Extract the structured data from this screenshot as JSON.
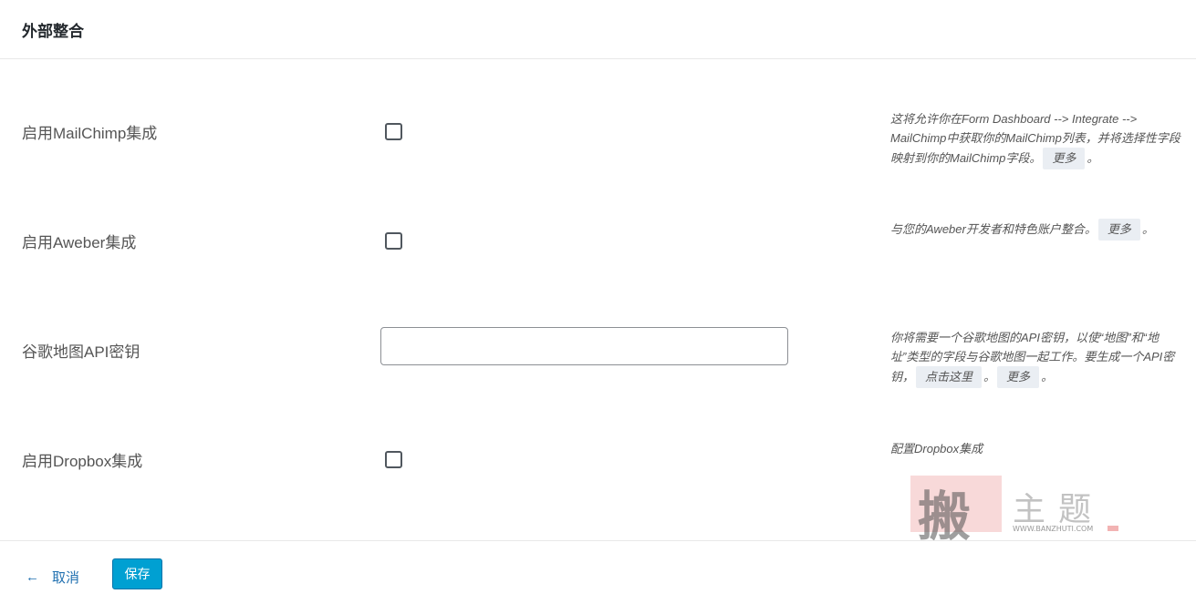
{
  "header": {
    "title": "外部整合"
  },
  "rows": [
    {
      "label": "启用MailChimp集成",
      "control": "checkbox",
      "checked": false,
      "desc_text": "这将允许你在Form Dashboard --> Integrate --> MailChimp中获取你的MailChimp列表，并将选择性字段映射到你的MailChimp字段。",
      "desc_links": [
        "更多"
      ],
      "desc_end": "。"
    },
    {
      "label": "启用Aweber集成",
      "control": "checkbox",
      "checked": false,
      "desc_text": "与您的Aweber开发者和特色账户整合。",
      "desc_links": [
        "更多"
      ],
      "desc_end": "。"
    },
    {
      "label": "谷歌地图API密钥",
      "control": "text",
      "value": "",
      "desc_text": "你将需要一个谷歌地图的API密钥，以使“地图”和“地址”类型的字段与谷歌地图一起工作。要生成一个API密钥，",
      "desc_links": [
        "点击这里",
        "更多"
      ],
      "desc_sep": "。",
      "desc_end": "。"
    },
    {
      "label": "启用Dropbox集成",
      "control": "checkbox",
      "checked": false,
      "desc_text": "配置Dropbox集成"
    }
  ],
  "watermark": {
    "seal_char": "搬",
    "text": "主题",
    "url": "WWW.BANZHUTI.COM"
  },
  "footer": {
    "cancel_icon": "arrow-left-icon",
    "cancel_arrow": "←",
    "cancel_label": "取消",
    "save_label": "保存"
  },
  "colors": {
    "accent": "#00a0d2",
    "link": "#2271b1"
  }
}
